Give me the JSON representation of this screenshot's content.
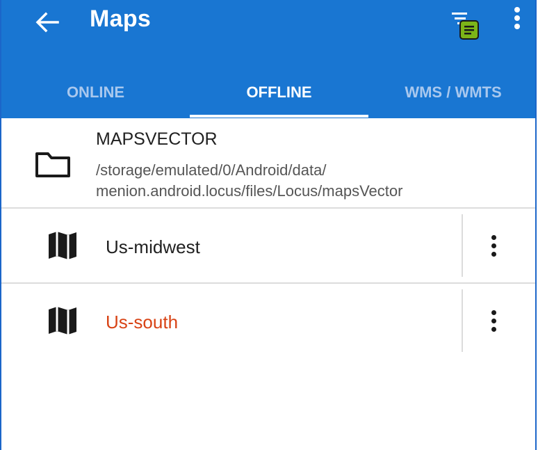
{
  "app_bar": {
    "title": "Maps",
    "back_icon": "arrow-left-icon",
    "filter_icon": "filter-list-icon",
    "menu_icon": "more-vert-icon",
    "color": "#1976d2"
  },
  "tabs": [
    {
      "label": "ONLINE",
      "active": false
    },
    {
      "label": "OFFLINE",
      "active": true
    },
    {
      "label": "WMS / WMTS",
      "active": false
    }
  ],
  "folder": {
    "name": "MAPSVECTOR",
    "path": "/storage/emulated/0/Android/data/\nmenion.android.locus/files/Locus/mapsVector",
    "icon": "folder-icon"
  },
  "maps": [
    {
      "name": "Us-midwest",
      "color": "#212121",
      "icon": "map-icon"
    },
    {
      "name": "Us-south",
      "color": "#d84315",
      "icon": "map-icon"
    }
  ]
}
